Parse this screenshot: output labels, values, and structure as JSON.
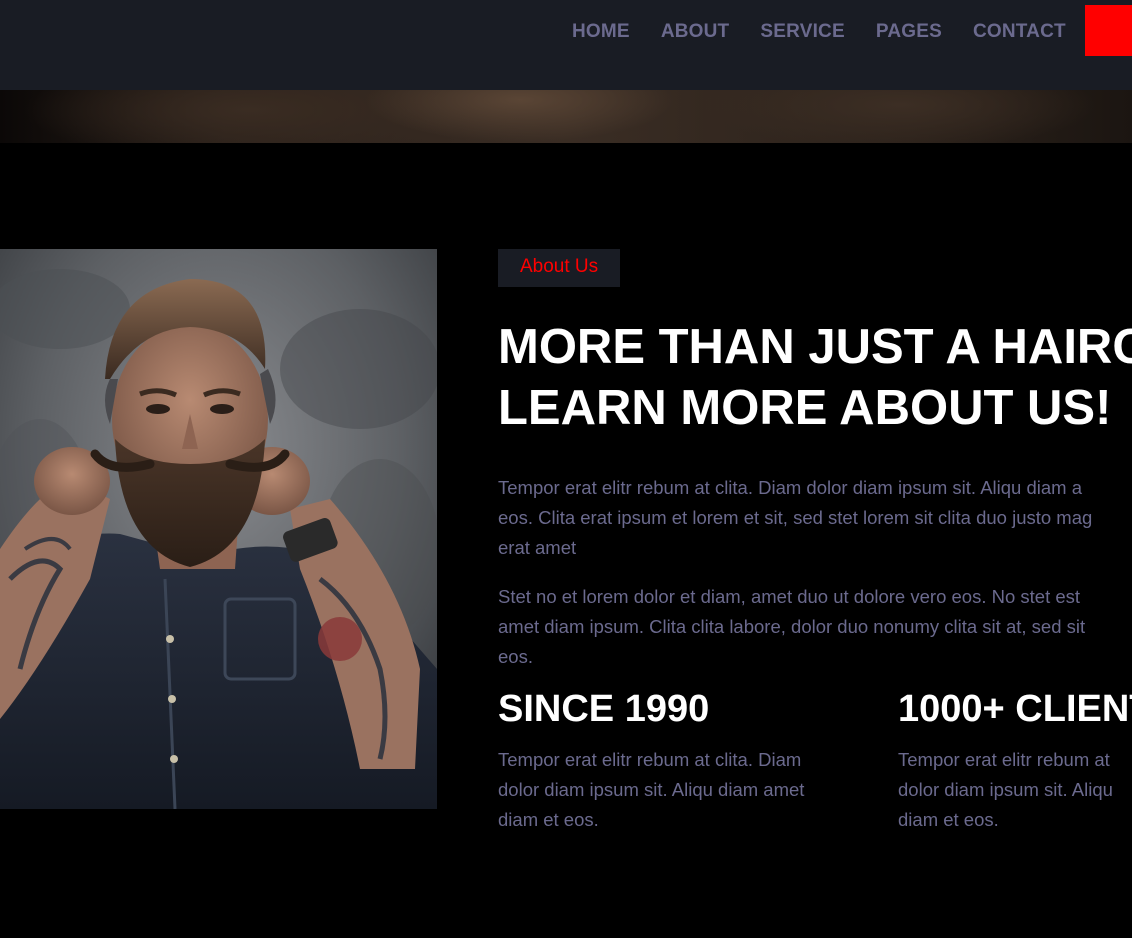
{
  "nav": {
    "items": [
      {
        "label": "HOME"
      },
      {
        "label": "ABOUT"
      },
      {
        "label": "SERVICE"
      },
      {
        "label": "PAGES"
      },
      {
        "label": "CONTACT"
      }
    ]
  },
  "colors": {
    "accent": "#ff0000",
    "navbar_bg": "#191c24",
    "muted_text": "#6b6a8e",
    "heading": "#ffffff"
  },
  "about": {
    "tag": "About Us",
    "title_line1": "MORE THAN JUST A HAIRC",
    "title_line2": "LEARN MORE ABOUT US!",
    "para1_lines": [
      "Tempor erat elitr rebum at clita. Diam dolor diam ipsum sit. Aliqu diam a",
      "eos. Clita erat ipsum et lorem et sit, sed stet lorem sit clita duo justo mag",
      "erat amet"
    ],
    "para2_lines": [
      "Stet no et lorem dolor et diam, amet duo ut dolore vero eos. No stet est",
      "amet diam ipsum. Clita clita labore, dolor duo nonumy clita sit at, sed sit",
      "eos."
    ],
    "stats": [
      {
        "title": "SINCE 1990",
        "lines": [
          "Tempor erat elitr rebum at clita. Diam",
          "dolor diam ipsum sit. Aliqu diam amet",
          "diam et eos."
        ]
      },
      {
        "title": "1000+ CLIENT",
        "lines": [
          "Tempor erat elitr rebum at",
          "dolor diam ipsum sit. Aliqu",
          "diam et eos."
        ]
      }
    ]
  }
}
